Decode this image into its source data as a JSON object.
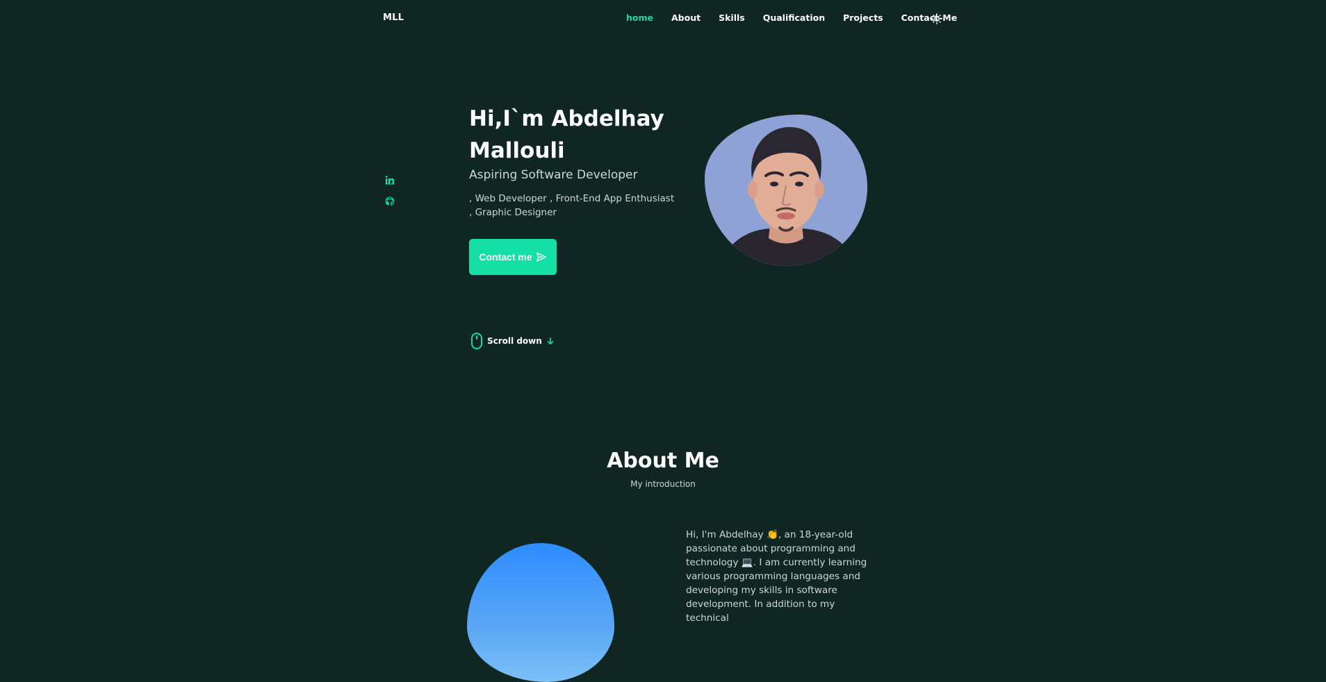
{
  "header": {
    "logo": "MLL",
    "nav": [
      {
        "label": "home",
        "active": true
      },
      {
        "label": "About"
      },
      {
        "label": "Skills"
      },
      {
        "label": "Qualification"
      },
      {
        "label": "Projects"
      },
      {
        "label": "Contact-Me"
      }
    ],
    "theme_icon": "sun-icon"
  },
  "social": {
    "items": [
      "linkedin-icon",
      "github-icon"
    ]
  },
  "hero": {
    "title": "Hi,I`m Abdelhay Mallouli",
    "subtitle": "Aspiring Software Developer",
    "description": ", Web Developer , Front-End App Enthusiast , Graphic Designer",
    "contact_button": "Contact me",
    "contact_icon": "send-icon"
  },
  "scroll": {
    "label": "Scroll down",
    "mouse_icon": "mouse-icon",
    "arrow_icon": "arrow-down-icon"
  },
  "about": {
    "title": "About Me",
    "subtitle": "My introduction",
    "text": "Hi, I'm Abdelhay 👏, an 18-year-old passionate about programming and technology 💻. I am currently learning various programming languages and developing my skills in software development. In addition to my technical"
  },
  "colors": {
    "background": "#0f2622",
    "accent": "#14e0a5",
    "active_nav": "#1fd7a0",
    "text_muted": "#cfd8d5",
    "avatar_bg": "#8ea2d6",
    "about_blob": "#2f8cff"
  }
}
